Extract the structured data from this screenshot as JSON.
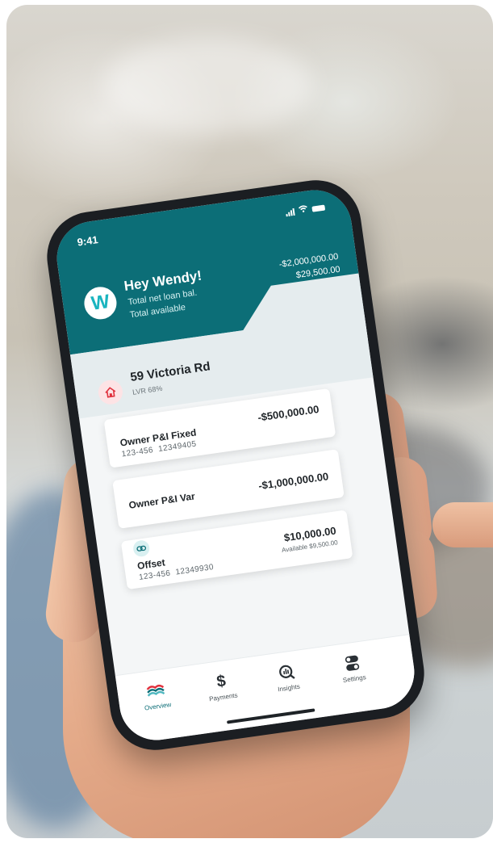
{
  "status_bar": {
    "time": "9:41"
  },
  "header": {
    "avatar_letter": "W",
    "greeting": "Hey Wendy!",
    "total_net_loan_label": "Total net loan bal.",
    "total_net_loan_value": "-$2,000,000.00",
    "total_available_label": "Total available",
    "total_available_value": "$29,500.00"
  },
  "property": {
    "icon": "house-icon",
    "name": "59 Victoria Rd",
    "lvr": "LVR 68%"
  },
  "accounts": [
    {
      "name": "Owner P&I Fixed",
      "bsb": "123-456",
      "number": "12349405",
      "balance": "-$500,000.00"
    },
    {
      "name": "Owner P&I Var",
      "balance": "-$1,000,000.00"
    },
    {
      "name": "Offset",
      "bsb": "123-456",
      "number": "12349930",
      "balance": "$10,000.00",
      "available": "Available $9,500.00",
      "icon": "link-icon"
    }
  ],
  "tabs": [
    {
      "label": "Overview",
      "icon": "overview-icon",
      "active": true
    },
    {
      "label": "Payments",
      "icon": "dollar-icon"
    },
    {
      "label": "Insights",
      "icon": "insights-icon"
    },
    {
      "label": "Settings",
      "icon": "settings-icon"
    }
  ],
  "colors": {
    "brand_teal": "#0c6e77",
    "avatar_teal": "#19b4bf",
    "house_red": "#e0303c"
  }
}
